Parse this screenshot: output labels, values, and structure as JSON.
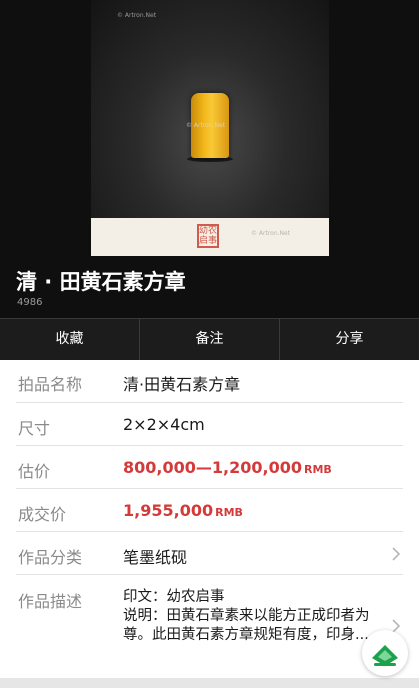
{
  "photo": {
    "watermark_top": "© Artron.Net",
    "watermark_mid": "© Artron.Net",
    "watermark_bottom": "© Artron.Net",
    "stamp_text": "幼农启事"
  },
  "header": {
    "title": "清 · 田黄石素方章",
    "lot_number": "4986"
  },
  "actions": [
    {
      "label": "收藏"
    },
    {
      "label": "备注"
    },
    {
      "label": "分享"
    }
  ],
  "details": {
    "name_label": "拍品名称",
    "name_value": "清·田黄石素方章",
    "size_label": "尺寸",
    "size_value": "2×2×4cm",
    "estimate_label": "估价",
    "estimate_value": "800,000—1,200,000",
    "estimate_unit": "RMB",
    "sold_label": "成交价",
    "sold_value": "1,955,000",
    "sold_unit": "RMB",
    "category_label": "作品分类",
    "category_value": "笔墨纸砚",
    "desc_label": "作品描述",
    "desc_line1": "印文：幼农启事",
    "desc_line2": "说明：田黄石章素来以能方正成印者为尊。此田黄石素方章规矩有度，印身..."
  },
  "colors": {
    "accent_price": "#d43a3a",
    "fab_green": "#1aa34a"
  }
}
